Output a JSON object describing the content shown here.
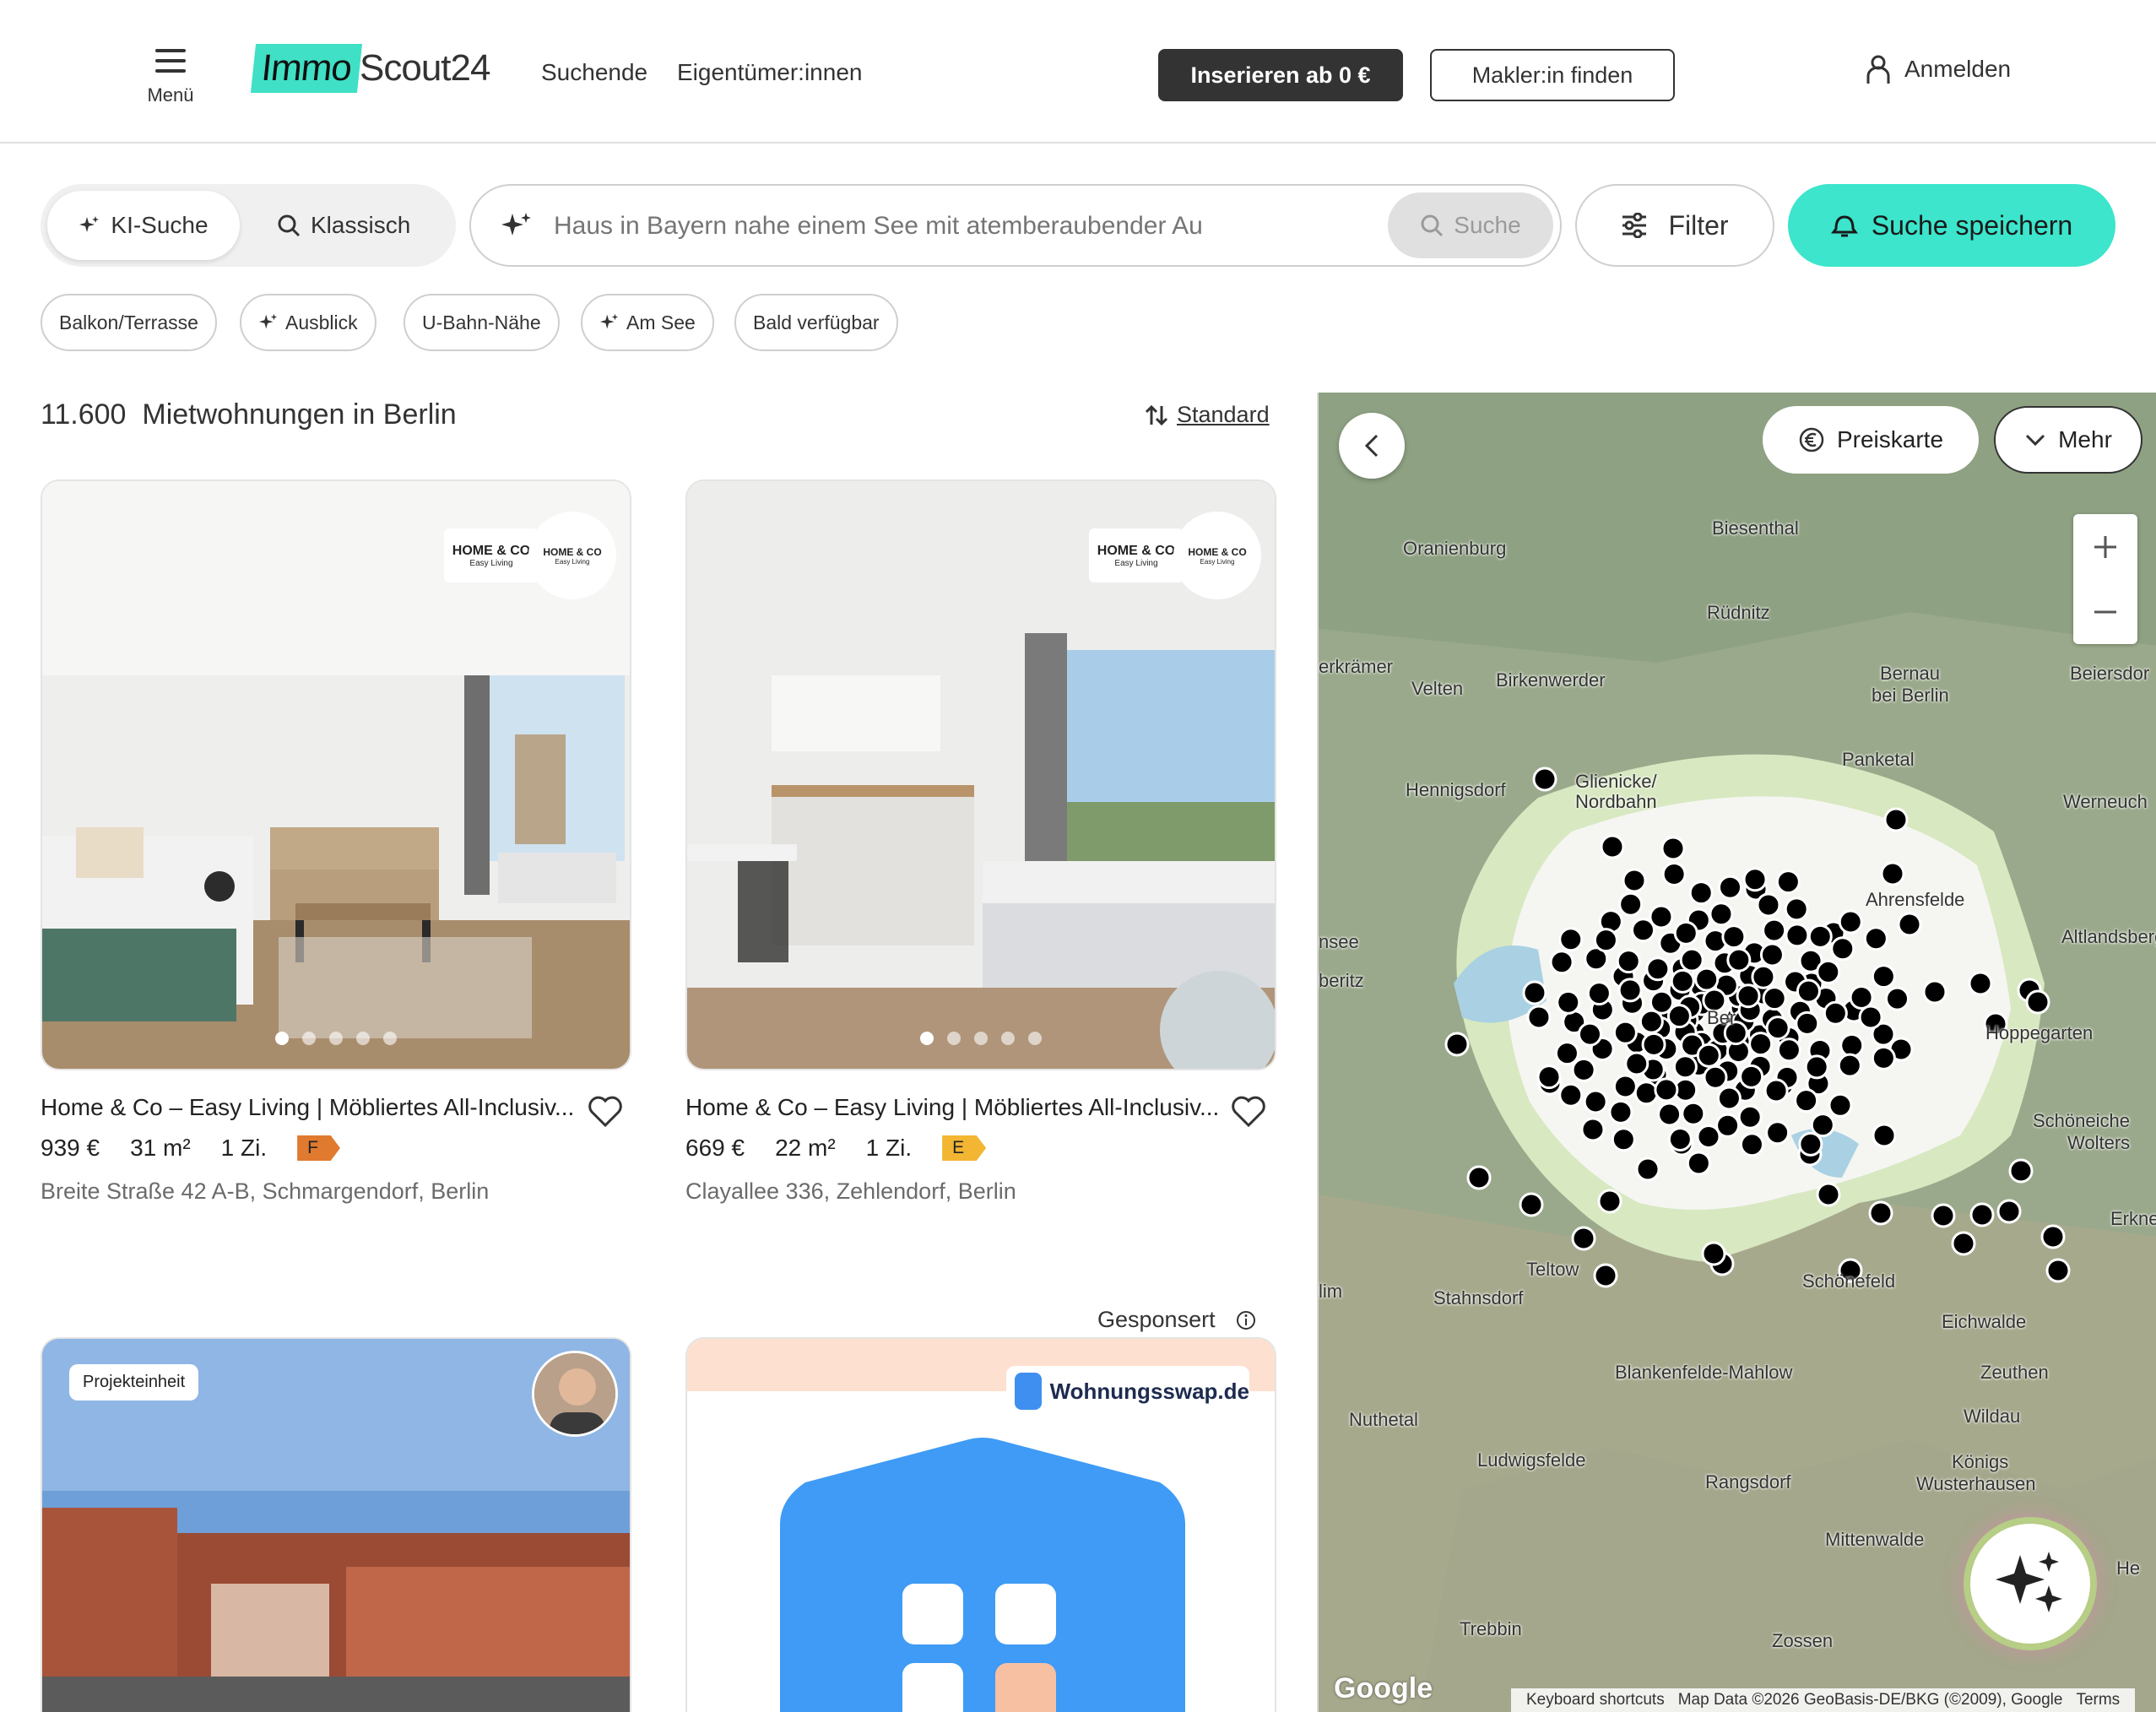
{
  "header": {
    "menu_label": "Menü",
    "logo_part1": "Immo",
    "logo_part2": "Scout24",
    "nav": [
      "Suchende",
      "Eigentümer:innen"
    ],
    "cta_dark": "Inserieren ab 0 €",
    "cta_outline": "Makler:in finden",
    "login": "Anmelden"
  },
  "search": {
    "mode_ai": "KI-Suche",
    "mode_classic": "Klassisch",
    "placeholder": "Haus in Bayern nahe einem See mit atemberaubender Au",
    "search_button": "Suche",
    "filter_button": "Filter",
    "save_button": "Suche speichern"
  },
  "chips": [
    {
      "label": "Balkon/Terrasse",
      "ai": false
    },
    {
      "label": "Ausblick",
      "ai": true
    },
    {
      "label": "U-Bahn-Nähe",
      "ai": false
    },
    {
      "label": "Am See",
      "ai": true
    },
    {
      "label": "Bald verfügbar",
      "ai": false
    }
  ],
  "results": {
    "count": "11.600",
    "label": "Mietwohnungen in Berlin",
    "sort_label": "Standard"
  },
  "listings": [
    {
      "title": "Home & Co – Easy Living | Möbliertes All-Inclusiv...",
      "price": "939 €",
      "area": "31 m²",
      "rooms": "1 Zi.",
      "energy_class": "F",
      "energy_color": "#e07a2e",
      "address": "Breite Straße 42 A-B, Schmargendorf, Berlin",
      "brand": "HOME & CO",
      "brand_sub": "Easy Living"
    },
    {
      "title": "Home & Co – Easy Living | Möbliertes All-Inclusiv...",
      "price": "669 €",
      "area": "22 m²",
      "rooms": "1 Zi.",
      "energy_class": "E",
      "energy_color": "#f2b632",
      "address": "Clayallee 336, Zehlendorf, Berlin",
      "brand": "HOME & CO",
      "brand_sub": "Easy Living"
    }
  ],
  "project_card": {
    "tag": "Projekteinheit"
  },
  "sponsored": {
    "label": "Gesponsert",
    "brand": "Wohnungsswap.de"
  },
  "map": {
    "price_map": "Preiskarte",
    "more": "Mehr",
    "places": [
      "Oranienburg",
      "Biesenthal",
      "Rüdnitz",
      "erkrämer",
      "Velten",
      "Birkenwerder",
      "Bernau",
      "bei Berlin",
      "Beiersdor",
      "Panketal",
      "Glienicke/",
      "Nordbahn",
      "Hennigsdorf",
      "Werneuch",
      "Ahrensfelde",
      "Altlandsberg",
      "nsee",
      "beritz",
      "Hoppegarten",
      "Schöneiche",
      "Wolters",
      "Erkne",
      "Teltow",
      "Stahnsdorf",
      "Schönefeld",
      "Eichwalde",
      "Zeuthen",
      "Wildau",
      "Blankenfelde-Mahlow",
      "Nuthetal",
      "Ludwigsfelde",
      "Rangsdorf",
      "Königs",
      "Wusterhausen",
      "Mittenwalde",
      "Trebbin",
      "Zossen",
      "He",
      "Be",
      "Ber",
      "lim"
    ],
    "footer": [
      "Keyboard shortcuts",
      "Map Data ©2026 GeoBasis-DE/BKG (©2009), Google",
      "Terms"
    ],
    "google": "Google"
  },
  "colors": {
    "accent": "#3ce5cb",
    "dark_button": "#333333",
    "map_bg": "#9aa98a"
  }
}
